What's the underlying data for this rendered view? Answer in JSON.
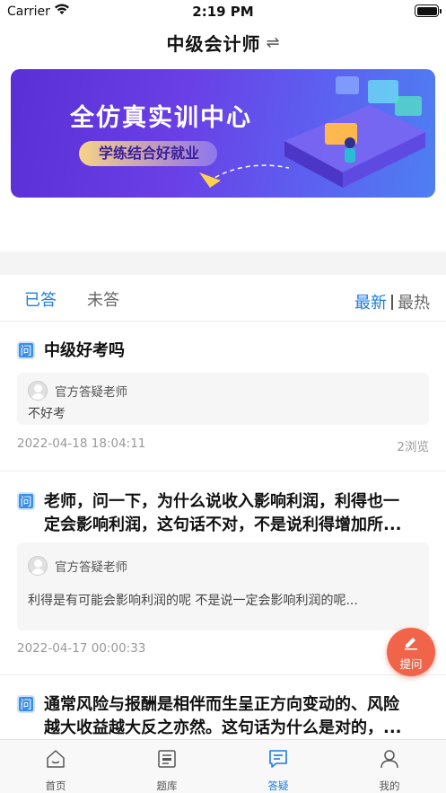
{
  "status_bar": {
    "carrier": "Carrier",
    "time": "2:19 PM"
  },
  "header": {
    "title": "中级会计师",
    "switch_icon": "⇌"
  },
  "banner": {
    "title": "全仿真实训中心",
    "subtitle": "学练结合好就业"
  },
  "tabs": {
    "answered": "已答",
    "unanswered": "未答"
  },
  "sort": {
    "newest": "最新",
    "hottest": "最热"
  },
  "questions": [
    {
      "icon": "问",
      "title": "中级好考吗",
      "teacher": "官方答疑老师",
      "answer": "不好考",
      "date": "2022-04-18 18:04:11",
      "views": "2浏览"
    },
    {
      "icon": "问",
      "title": "老师，问一下，为什么说收入影响利润，利得也一定会影响利润，这句话不对，不是说利得增加所...",
      "title_line1": "老师，问一下，为什么说收入影响利润，利得也一",
      "title_line2": "定会影响利润，这句话不对，不是说利得增加所...",
      "teacher": "官方答疑老师",
      "answer": "利得是有可能会影响利润的呢 不是说一定会影响利润的呢...",
      "date": "2022-04-17 00:00:33",
      "views": ""
    },
    {
      "icon": "问",
      "title_line1": "通常风险与报酬是相伴而生呈正方向变动的、风险",
      "title_line2": "越大收益越大反之亦然。这句话为什么是对的，..."
    }
  ],
  "ask_button": {
    "label": "提问"
  },
  "tabbar": [
    {
      "label": "首页",
      "icon": "home-icon"
    },
    {
      "label": "题库",
      "icon": "question-bank-icon"
    },
    {
      "label": "答疑",
      "icon": "qa-icon",
      "active": true
    },
    {
      "label": "我的",
      "icon": "profile-icon"
    }
  ],
  "colors": {
    "accent": "#1d7ce0",
    "ask": "#f0654a",
    "banner": "#5a2fd6"
  }
}
